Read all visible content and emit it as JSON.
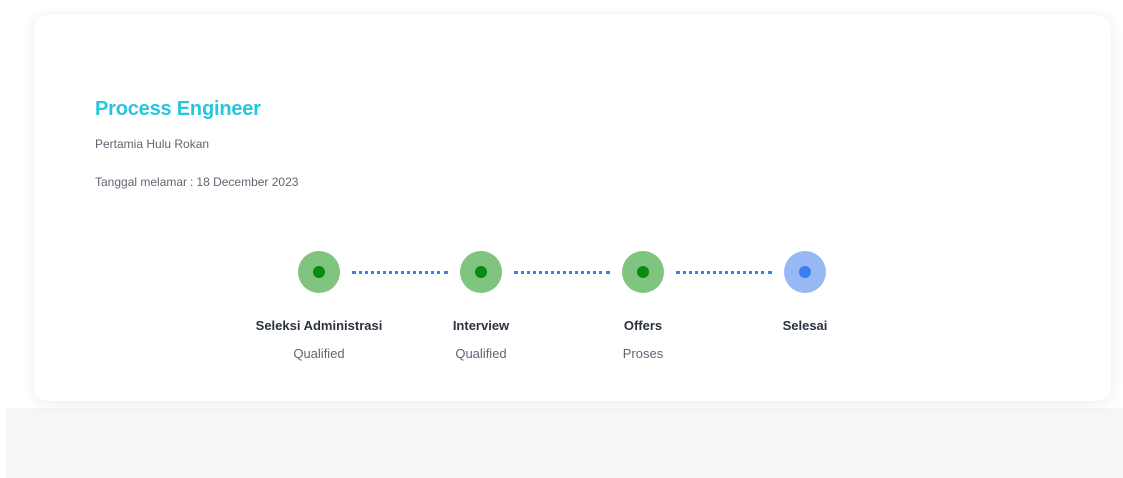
{
  "job": {
    "title": "Process Engineer",
    "company": "Pertamia Hulu Rokan",
    "applied_label": "Tanggal melamar",
    "applied_date": "18 December 2023"
  },
  "steps": [
    {
      "label": "Seleksi Administrasi",
      "status": "Qualified",
      "state": "done"
    },
    {
      "label": "Interview",
      "status": "Qualified",
      "state": "done"
    },
    {
      "label": "Offers",
      "status": "Proses",
      "state": "done"
    },
    {
      "label": "Selesai",
      "status": "",
      "state": "current"
    }
  ],
  "colors": {
    "title": "#26c6e0",
    "step_done_bg": "#7fc47f",
    "step_done_dot": "#0b8a12",
    "step_current_bg": "#98b8f5",
    "step_current_dot": "#3b7ef0",
    "connector": "#3b7ef0"
  }
}
